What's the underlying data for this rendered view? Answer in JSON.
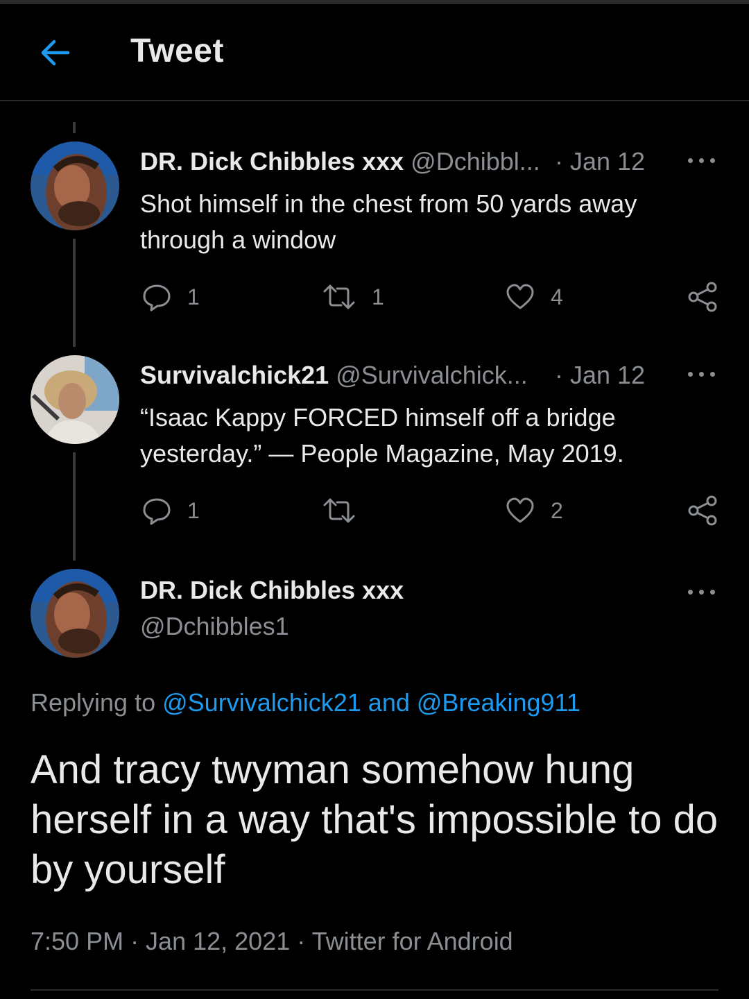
{
  "header": {
    "title": "Tweet"
  },
  "colors": {
    "background": "#000000",
    "text": "#e7e9ea",
    "secondary": "#8b8f93",
    "link": "#1d9bf0"
  },
  "tweets": [
    {
      "name": "DR. Dick Chibbles xxx",
      "handle": "@Dchibbl...",
      "date": "· Jan 12",
      "text": "Shot himself in the chest from 50 yards away through a window",
      "replies": "1",
      "retweets": "1",
      "likes": "4"
    },
    {
      "name": "Survivalchick21",
      "handle": "@Survivalchick...",
      "date": "· Jan 12",
      "text": "“Isaac Kappy FORCED himself off a bridge yesterday.” — People Magazine, May 2019.",
      "replies": "1",
      "retweets": "",
      "likes": "2"
    }
  ],
  "main": {
    "name": "DR. Dick Chibbles xxx",
    "handle": "@Dchibbles1",
    "replying_prefix": "Replying to",
    "replying_user1": "@Survivalchick21",
    "replying_and": "and",
    "replying_user2": "@Breaking911",
    "text": "And tracy twyman somehow hung herself in a way that's impossible to do by yourself",
    "meta": "7:50 PM · Jan 12, 2021 · Twitter for Android"
  }
}
